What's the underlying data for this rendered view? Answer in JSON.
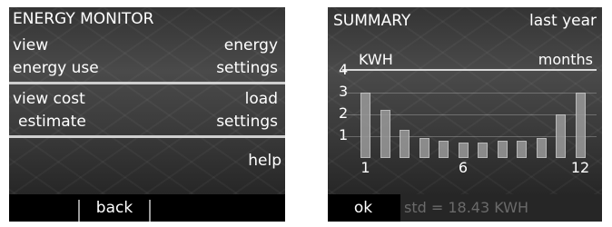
{
  "left": {
    "title": "ENERGY MONITOR",
    "view_energy_line1": "view",
    "view_energy_line2": "energy use",
    "energy_settings_line1": "energy",
    "energy_settings_line2": "settings",
    "view_cost_line1": "view cost",
    "view_cost_line2": "estimate",
    "load_settings_line1": "load",
    "load_settings_line2": "settings",
    "help": "help",
    "back": "back"
  },
  "right": {
    "title": "SUMMARY",
    "period": "last year",
    "ok": "ok",
    "std_text": "std = 18.43 KWH"
  },
  "chart_data": {
    "type": "bar",
    "ylabel": "KWH",
    "xlabel": "months",
    "y_ticks": [
      "1",
      "2",
      "3",
      "4"
    ],
    "x_ticks": [
      "1",
      "6",
      "12"
    ],
    "ylim": [
      0,
      4
    ],
    "categories": [
      "1",
      "2",
      "3",
      "4",
      "5",
      "6",
      "7",
      "8",
      "9",
      "10",
      "11",
      "12"
    ],
    "values": [
      3.0,
      2.2,
      1.3,
      0.9,
      0.8,
      0.7,
      0.7,
      0.8,
      0.8,
      0.9,
      2.0,
      3.0
    ]
  },
  "colors": {
    "screen_dark": "#1e1e1e",
    "text": "#ffffff",
    "divider": "#cfcfcf",
    "softbar": "#000000"
  }
}
